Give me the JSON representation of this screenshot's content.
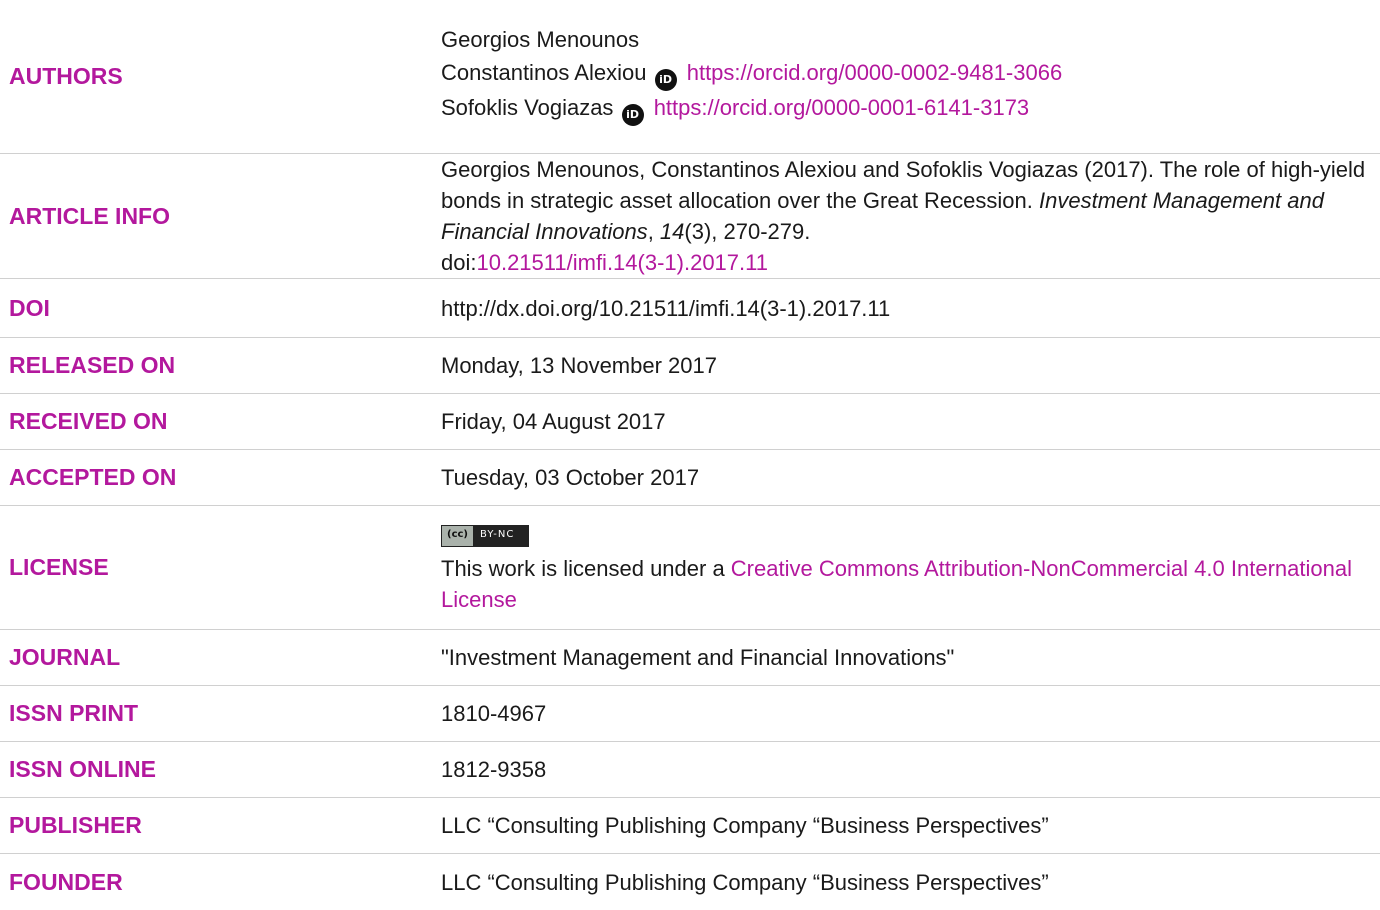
{
  "authors": {
    "label": "AUTHORS",
    "list": [
      {
        "name": "Georgios Menounos"
      },
      {
        "name": "Constantinos Alexiou",
        "orcid_icon": "iD",
        "orcid_url": "https://orcid.org/0000-0002-9481-3066"
      },
      {
        "name": "Sofoklis Vogiazas",
        "orcid_icon": "iD",
        "orcid_url": "https://orcid.org/0000-0001-6141-3173"
      }
    ]
  },
  "article_info": {
    "label": "ARTICLE INFO",
    "citation_authors": "Georgios Menounos, Constantinos Alexiou and Sofoklis Vogiazas (2017). The role of high-yield bonds in strategic asset allocation over the Great Recession.",
    "journal_italic": "Investment Management and Financial Innovations",
    "sep1": ", ",
    "volume_italic": "14",
    "issue_pages": "(3), 270-279.",
    "doi_prefix": "doi:",
    "doi_link": "10.21511/imfi.14(3-1).2017.11"
  },
  "doi": {
    "label": "DOI",
    "value": "http://dx.doi.org/10.21511/imfi.14(3-1).2017.11"
  },
  "released_on": {
    "label": "RELEASED ON",
    "value": "Monday, 13 November 2017"
  },
  "received_on": {
    "label": "RECEIVED ON",
    "value": "Friday, 04 August 2017"
  },
  "accepted_on": {
    "label": "ACCEPTED ON",
    "value": "Tuesday, 03 October 2017"
  },
  "license": {
    "label": "LICENSE",
    "badge_left": "(cc)",
    "badge_right": "BY-NC",
    "text_prefix": "This work is licensed under a ",
    "link_text": "Creative Commons Attribution-NonCommercial 4.0 International License"
  },
  "journal": {
    "label": "JOURNAL",
    "value": "\"Investment Management and Financial Innovations\""
  },
  "issn_print": {
    "label": "ISSN PRINT",
    "value": "1810-4967"
  },
  "issn_online": {
    "label": "ISSN ONLINE",
    "value": "1812-9358"
  },
  "publisher": {
    "label": "PUBLISHER",
    "value": "LLC “Consulting Publishing Company “Business Perspectives”"
  },
  "founder": {
    "label": "FOUNDER",
    "value": "LLC “Consulting Publishing Company “Business Perspectives”"
  },
  "colors": {
    "accent": "#b3189d",
    "text": "#1a1a1a",
    "divider": "#d0d0d0"
  }
}
